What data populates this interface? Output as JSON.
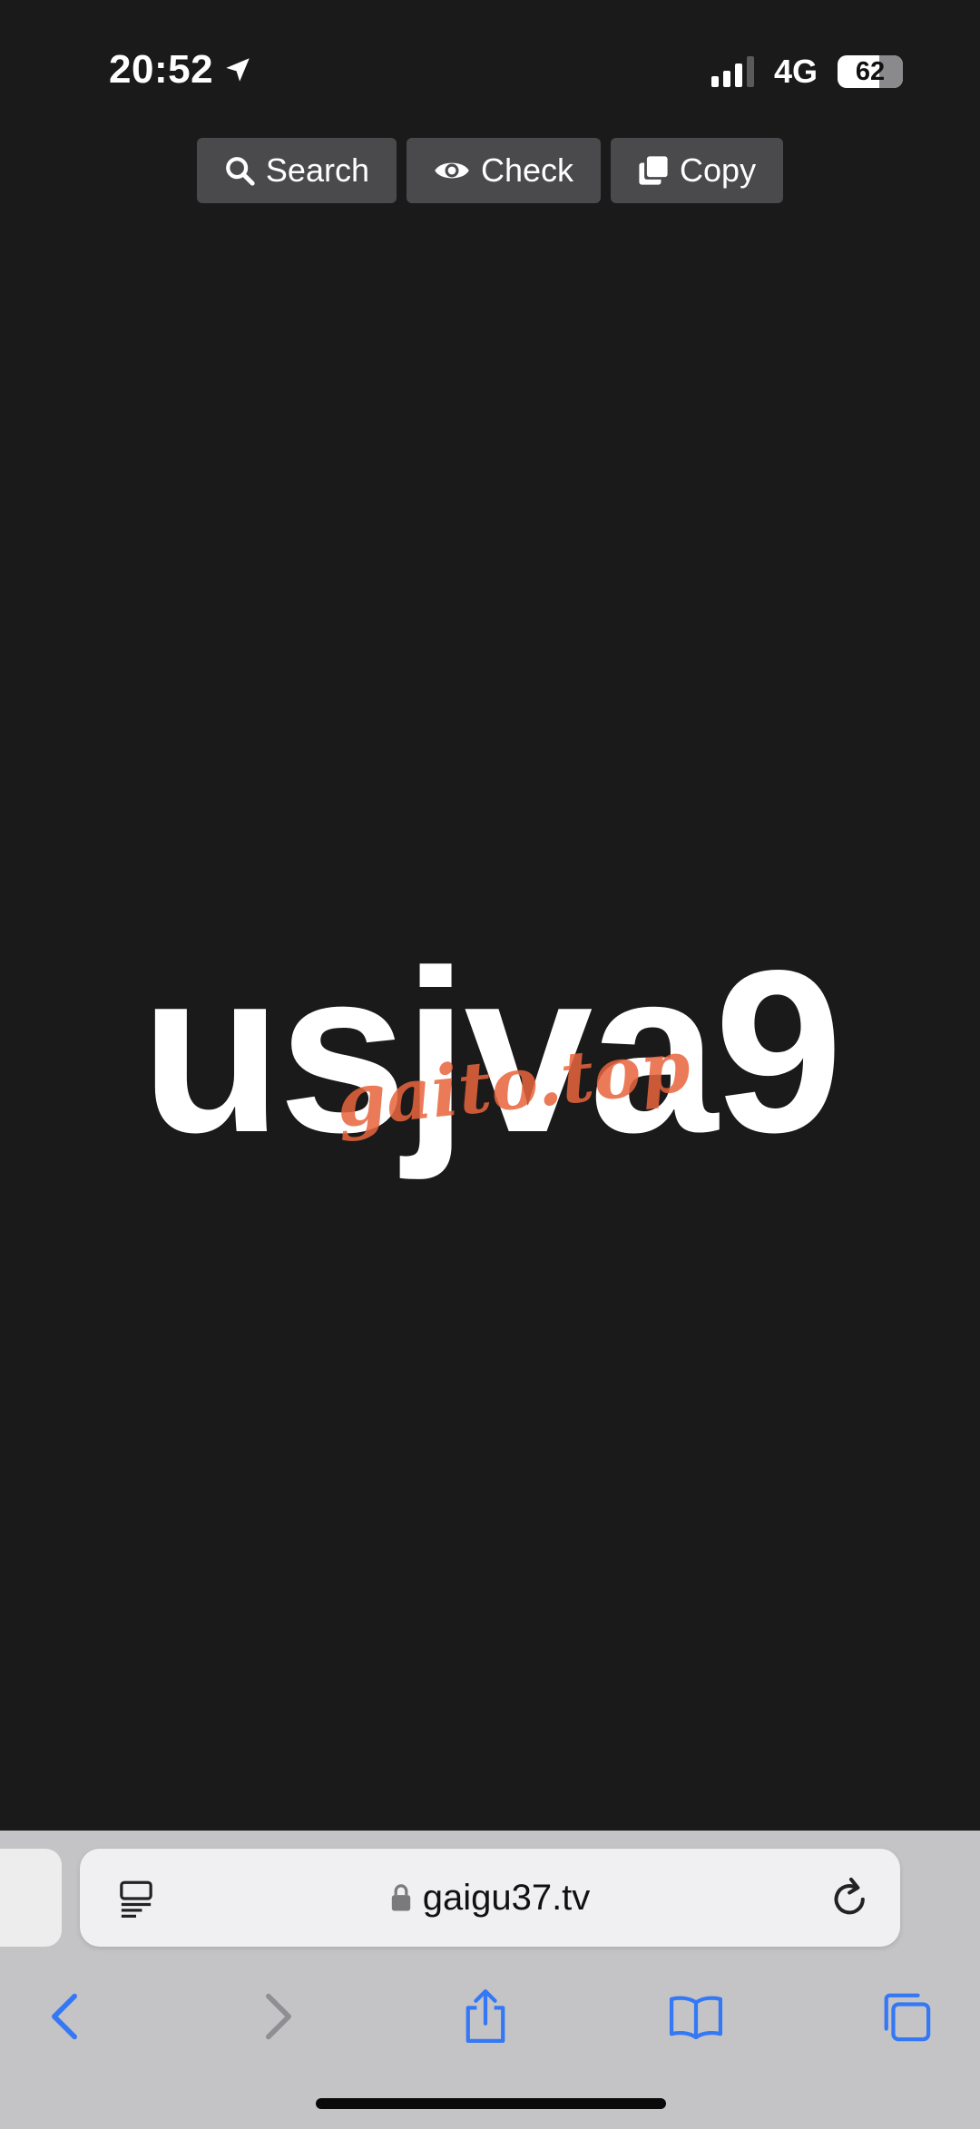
{
  "status": {
    "time": "20:52",
    "network": "4G",
    "battery": "62",
    "location_icon": "location-arrow-icon"
  },
  "toolbar_top": {
    "search_label": "Search",
    "check_label": "Check",
    "copy_label": "Copy"
  },
  "main": {
    "code": "usjva9",
    "watermark": "gaito.top"
  },
  "browser": {
    "url": "gaigu37.tv",
    "icons": [
      "reader-icon",
      "lock-icon",
      "reload-icon",
      "back-icon",
      "forward-icon",
      "share-icon",
      "bookmarks-icon",
      "tabs-icon"
    ]
  },
  "colors": {
    "background": "#1a1a1b",
    "button_bg": "#4a4a4c",
    "watermark": "#e8643c",
    "ios_blue": "#3478f6"
  }
}
